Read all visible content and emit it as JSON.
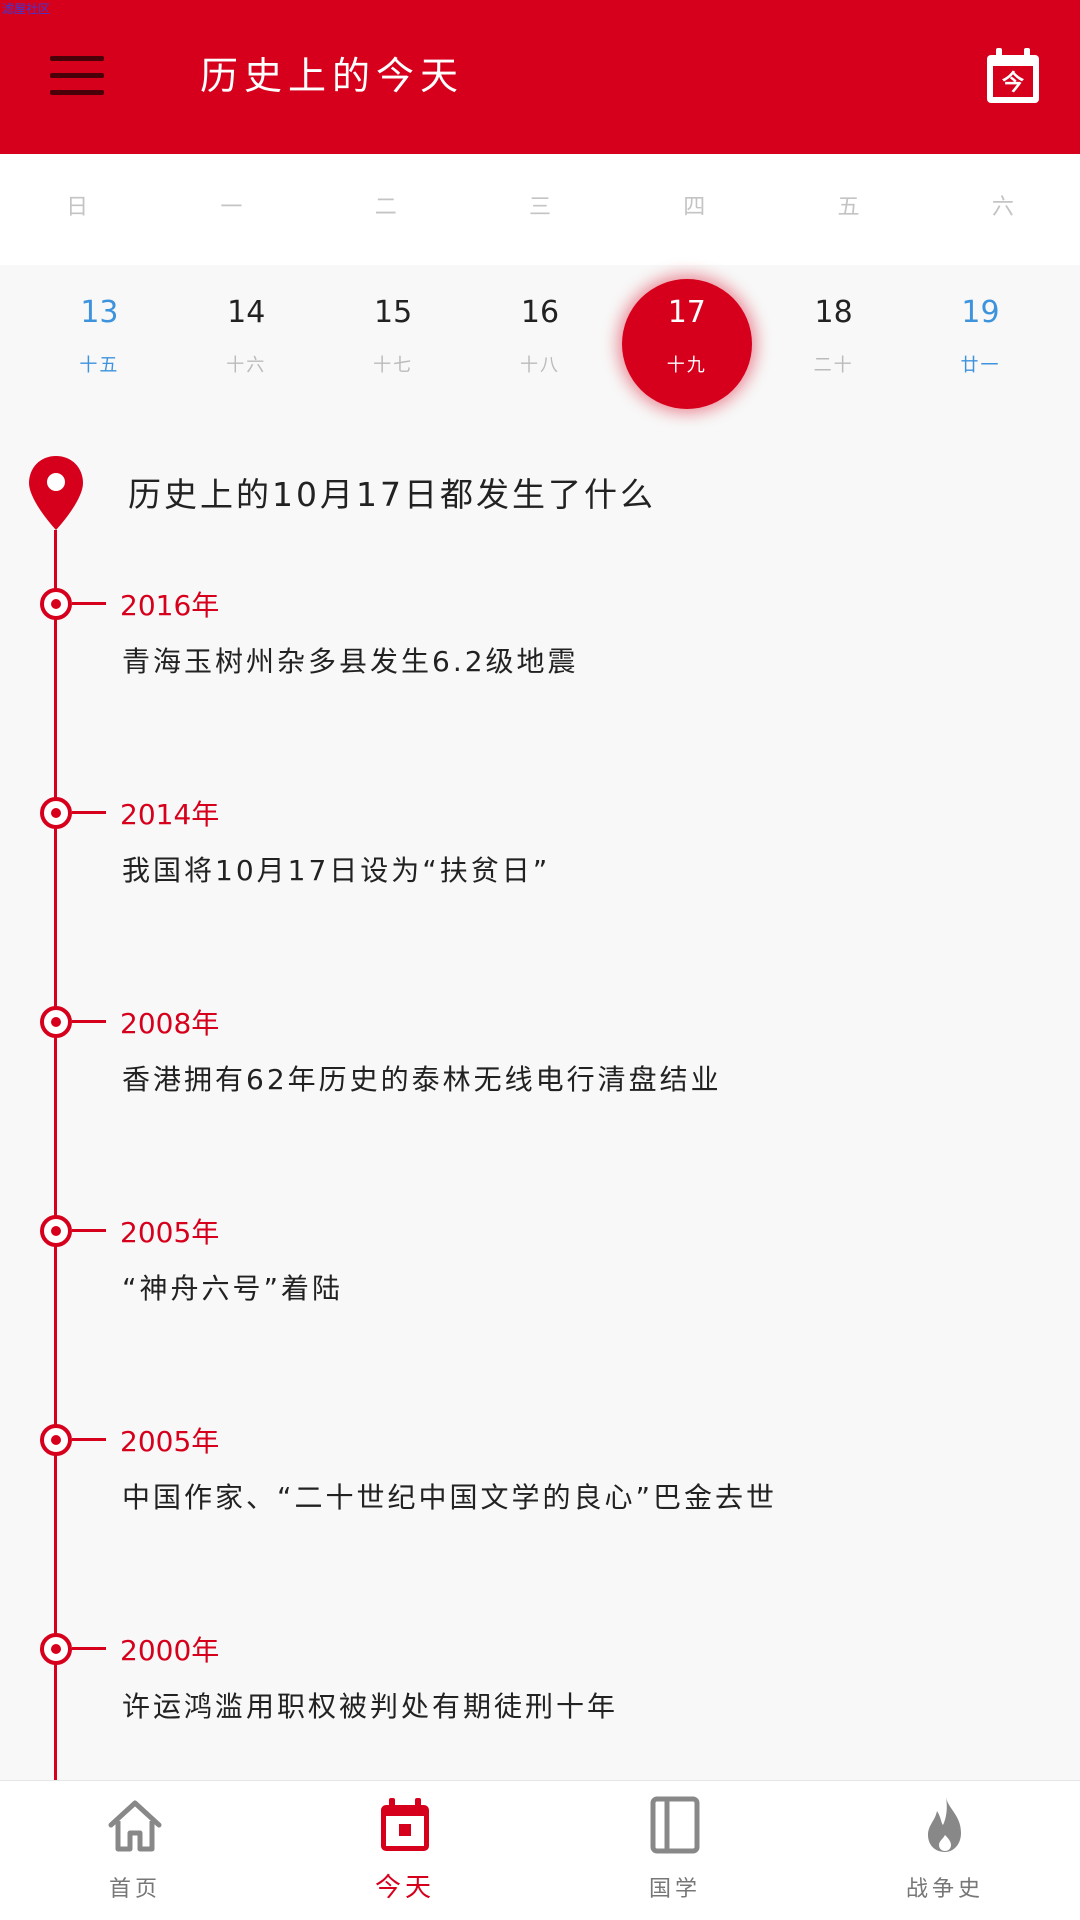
{
  "watermark": "滤屋社区",
  "header": {
    "title": "历史上的今天",
    "today_icon_char": "今",
    "icons": [
      "menu-icon",
      "calendar-today-icon"
    ]
  },
  "colors": {
    "brand": "#d6001c",
    "weekend": "#3e93dd",
    "muted": "#bbbbbb"
  },
  "weekdays": [
    "日",
    "一",
    "二",
    "三",
    "四",
    "五",
    "六"
  ],
  "dates": [
    {
      "day": "13",
      "lunar": "十五",
      "weekend": true
    },
    {
      "day": "14",
      "lunar": "十六"
    },
    {
      "day": "15",
      "lunar": "十七"
    },
    {
      "day": "16",
      "lunar": "十八"
    },
    {
      "day": "17",
      "lunar": "十九",
      "selected": true
    },
    {
      "day": "18",
      "lunar": "二十"
    },
    {
      "day": "19",
      "lunar": "廿一",
      "weekend": true
    }
  ],
  "section_title": "历史上的10月17日都发生了什么",
  "events": [
    {
      "year": "2016年",
      "text": "青海玉树州杂多县发生6.2级地震"
    },
    {
      "year": "2014年",
      "text": "我国将10月17日设为“扶贫日”"
    },
    {
      "year": "2008年",
      "text": "香港拥有62年历史的泰林无线电行清盘结业"
    },
    {
      "year": "2005年",
      "text": "“神舟六号”着陆"
    },
    {
      "year": "2005年",
      "text": "中国作家、“二十世纪中国文学的良心”巴金去世"
    },
    {
      "year": "2000年",
      "text": "许运鸿滥用职权被判处有期徒刑十年"
    }
  ],
  "tabbar": {
    "items": [
      {
        "label": "首页",
        "icon": "home-icon"
      },
      {
        "label": "今天",
        "icon": "calendar-icon",
        "active": true
      },
      {
        "label": "国学",
        "icon": "book-icon"
      },
      {
        "label": "战争史",
        "icon": "flame-icon"
      }
    ]
  }
}
